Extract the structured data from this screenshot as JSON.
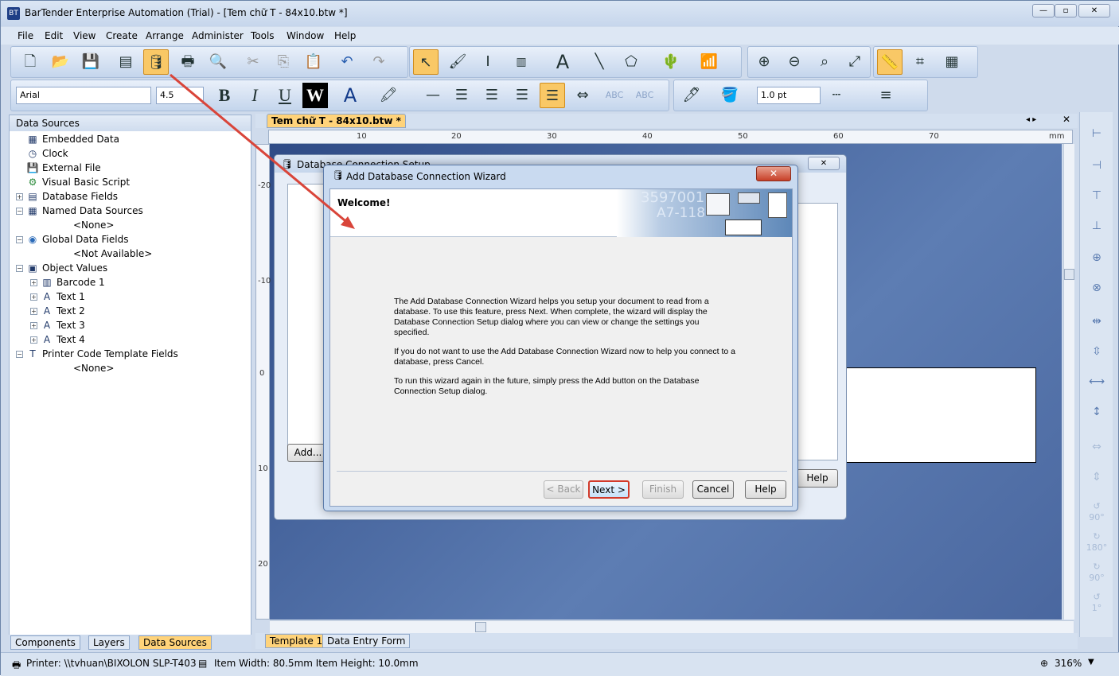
{
  "app": {
    "title": "BarTender Enterprise Automation (Trial) - [Tem chữ T - 84x10.btw *]",
    "window_buttons": [
      "—",
      "▫",
      "✕"
    ]
  },
  "menu": [
    "File",
    "Edit",
    "View",
    "Create",
    "Arrange",
    "Administer",
    "Tools",
    "Window",
    "Help"
  ],
  "format_toolbar": {
    "font": "Arial",
    "size": "4.5",
    "bold": "B",
    "italic": "I",
    "underline": "U",
    "wide": "W",
    "line_width": "1.0 pt"
  },
  "data_sources_panel": {
    "title": "Data Sources",
    "items": [
      {
        "label": "Embedded Data",
        "level": 0
      },
      {
        "label": "Clock",
        "level": 0
      },
      {
        "label": "External File",
        "level": 0
      },
      {
        "label": "Visual Basic Script",
        "level": 0
      },
      {
        "label": "Database Fields",
        "level": 0,
        "expander": "+"
      },
      {
        "label": "Named Data Sources",
        "level": 0,
        "expander": "−"
      },
      {
        "label": "<None>",
        "level": 1
      },
      {
        "label": "Global Data Fields",
        "level": 0,
        "expander": "−"
      },
      {
        "label": "<Not Available>",
        "level": 1
      },
      {
        "label": "Object Values",
        "level": 0,
        "expander": "−"
      },
      {
        "label": "Barcode 1",
        "level": 1,
        "expander": "+"
      },
      {
        "label": "Text 1",
        "level": 1,
        "expander": "+"
      },
      {
        "label": "Text 2",
        "level": 1,
        "expander": "+"
      },
      {
        "label": "Text 3",
        "level": 1,
        "expander": "+"
      },
      {
        "label": "Text 4",
        "level": 1,
        "expander": "+"
      },
      {
        "label": "Printer Code Template Fields",
        "level": 0,
        "expander": "−"
      },
      {
        "label": "<None>",
        "level": 1
      }
    ],
    "bottom_tabs": [
      "Components",
      "Layers",
      "Data Sources"
    ]
  },
  "document": {
    "tab": "Tem chữ T - 84x10.btw *",
    "ruler_h": [
      "10",
      "20",
      "30",
      "40",
      "50",
      "60",
      "70",
      "mm"
    ],
    "ruler_v": [
      "-20",
      "-10",
      "0",
      "10",
      "20"
    ],
    "bottom_tabs": [
      "Template 1",
      "Data Entry Form"
    ]
  },
  "background_dialog": {
    "title": "Database Connection Setup",
    "add_button": "Add...",
    "help_button": "Help"
  },
  "wizard": {
    "title": "Add Database Connection Wizard",
    "heading": "Welcome!",
    "graphic_text": [
      "3597001",
      "A7-118"
    ],
    "paragraphs": [
      "The Add Database Connection Wizard helps you setup your document to read from a database. To use this feature, press Next.  When complete, the wizard will display the Database Connection Setup dialog where you can view or change the settings you specified.",
      "If you do not want to use the Add Database Connection Wizard now to help you connect to a database, press Cancel.",
      "To run this wizard again in the future, simply press the Add button on the Database Connection Setup dialog."
    ],
    "buttons": {
      "back": "< Back",
      "next": "Next >",
      "finish": "Finish",
      "cancel": "Cancel",
      "help": "Help"
    }
  },
  "right_toolbar": {
    "rotate_labels": [
      "90°",
      "180°",
      "90°",
      "1°"
    ]
  },
  "status": {
    "printer": "Printer: \\\\tvhuan\\BIXOLON SLP-T403",
    "item_size": "Item Width: 80.5mm  Item Height: 10.0mm",
    "zoom": "316%"
  }
}
